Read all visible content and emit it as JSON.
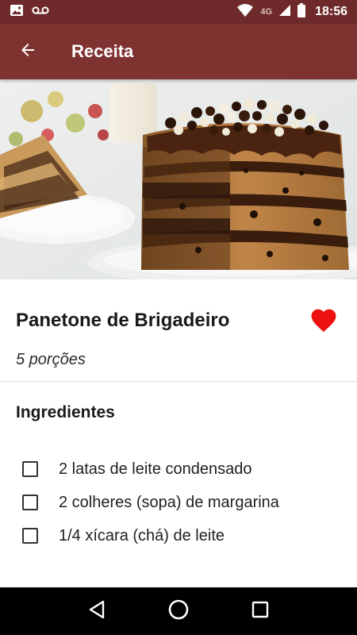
{
  "status_bar": {
    "time": "18:56",
    "network_label": "4G",
    "icons": [
      "image-icon",
      "voicemail-icon",
      "wifi-icon",
      "cell-signal-icon",
      "battery-icon"
    ]
  },
  "app_bar": {
    "title": "Receita",
    "back_icon": "arrow-left-icon",
    "color": "#7f3331"
  },
  "hero": {
    "image": "panettone-brigadeiro-cake-photo"
  },
  "recipe": {
    "title": "Panetone de Brigadeiro",
    "servings": "5 porções",
    "favorite": true,
    "favorite_color": "#ee1111"
  },
  "ingredients": {
    "heading": "Ingredientes",
    "items": [
      {
        "text": "2 latas de leite condensado",
        "checked": false
      },
      {
        "text": "2 colheres (sopa) de margarina",
        "checked": false
      },
      {
        "text": "1/4 xícara (chá) de leite",
        "checked": false
      }
    ]
  },
  "nav_bar": {
    "buttons": [
      "back-triangle-icon",
      "home-circle-icon",
      "recents-square-icon"
    ]
  }
}
